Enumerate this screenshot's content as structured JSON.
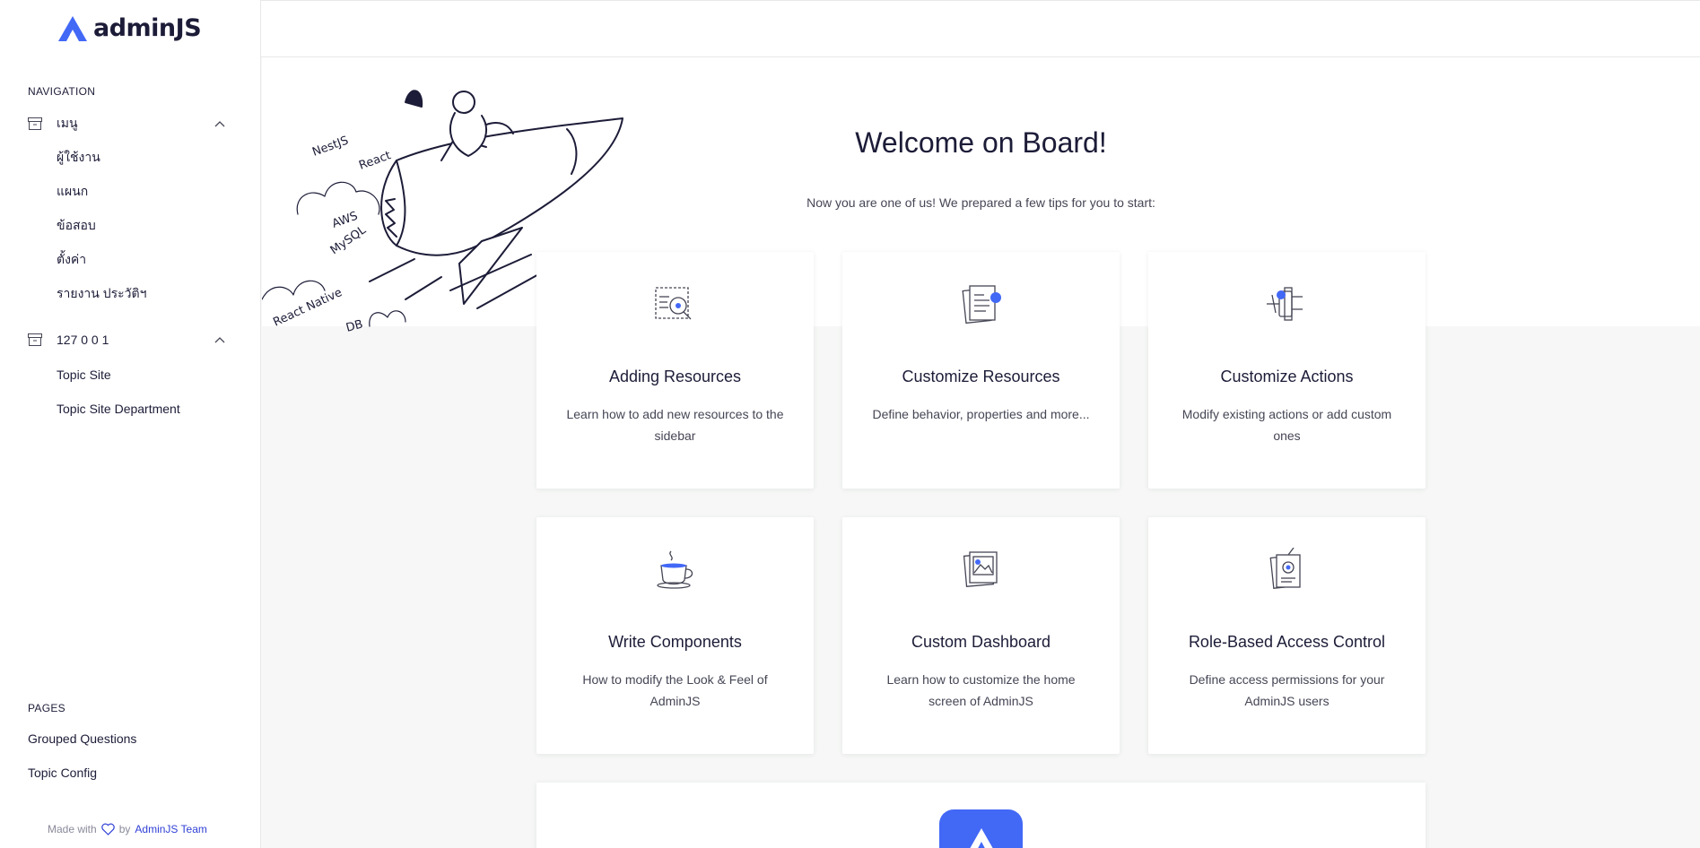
{
  "app": {
    "logo_text": "adminJS"
  },
  "sidebar": {
    "navigation_title": "NAVIGATION",
    "groups": [
      {
        "label": "เมนู",
        "items": [
          "ผู้ใช้งาน",
          "แผนก",
          "ข้อสอบ",
          "ตั้งค่า",
          "รายงาน ประวัติฯ"
        ]
      },
      {
        "label": "127 0 0 1",
        "items": [
          "Topic Site",
          "Topic Site Department"
        ]
      }
    ],
    "pages_title": "PAGES",
    "pages": [
      "Grouped Questions",
      "Topic Config"
    ],
    "footer": {
      "made_with": "Made with",
      "by": "by",
      "team": "AdminJS Team"
    }
  },
  "hero": {
    "title": "Welcome on Board!",
    "subtitle": "Now you are one of us! We prepared a few tips for you to start:",
    "illustration_labels": [
      "NestJS",
      "React",
      "AWS",
      "MySQL",
      "React Native",
      "DB"
    ]
  },
  "cards": [
    {
      "icon": "magnifier-document-icon",
      "title": "Adding Resources",
      "description": "Learn how to add new resources to the sidebar"
    },
    {
      "icon": "documents-icon",
      "title": "Customize Resources",
      "description": "Define behavior, properties and more..."
    },
    {
      "icon": "plug-icon",
      "title": "Customize Actions",
      "description": "Modify existing actions or add custom ones"
    },
    {
      "icon": "coffee-cup-icon",
      "title": "Write Components",
      "description": "How to modify the Look & Feel of AdminJS"
    },
    {
      "icon": "photo-frames-icon",
      "title": "Custom Dashboard",
      "description": "Learn how to customize the home screen of AdminJS"
    },
    {
      "icon": "id-badge-icon",
      "title": "Role-Based Access Control",
      "description": "Define access permissions for your AdminJS users"
    }
  ],
  "colors": {
    "accent": "#4268F6",
    "text": "#1C1C38",
    "muted": "#454655",
    "background": "#F6F7F6"
  }
}
